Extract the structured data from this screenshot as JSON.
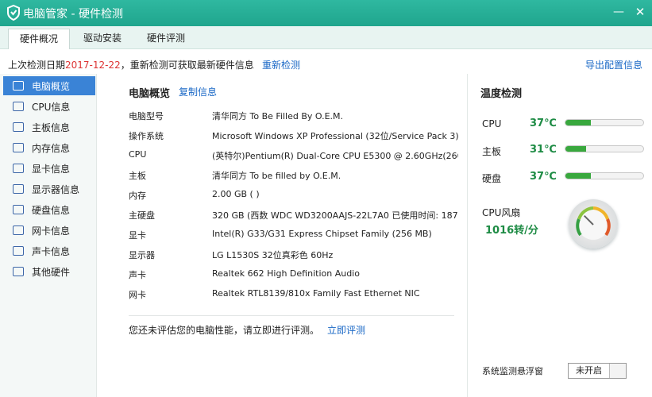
{
  "window": {
    "title": "电脑管家 - 硬件检测",
    "minimize_glyph": "—",
    "close_glyph": "✕",
    "accent": "#24ad94"
  },
  "tabs": [
    {
      "label": "硬件概况",
      "active": true
    },
    {
      "label": "驱动安装",
      "active": false
    },
    {
      "label": "硬件评测",
      "active": false
    }
  ],
  "infobar": {
    "prefix": "上次检测日期",
    "date": "2017-12-22",
    "suffix": "，重新检测可获取最新硬件信息",
    "rescan": "重新检测",
    "export": "导出配置信息"
  },
  "sidebar": {
    "items": [
      {
        "label": "电脑概览",
        "icon": "monitor-icon",
        "active": true
      },
      {
        "label": "CPU信息",
        "icon": "cpu-icon"
      },
      {
        "label": "主板信息",
        "icon": "motherboard-icon"
      },
      {
        "label": "内存信息",
        "icon": "memory-icon"
      },
      {
        "label": "显卡信息",
        "icon": "graphics-card-icon"
      },
      {
        "label": "显示器信息",
        "icon": "display-icon"
      },
      {
        "label": "硬盘信息",
        "icon": "hard-disk-icon"
      },
      {
        "label": "网卡信息",
        "icon": "network-card-icon"
      },
      {
        "label": "声卡信息",
        "icon": "sound-card-icon"
      },
      {
        "label": "其他硬件",
        "icon": "other-hardware-icon"
      }
    ]
  },
  "overview": {
    "title": "电脑概览",
    "copy": "复制信息",
    "rows": [
      {
        "key": "电脑型号",
        "value": "清华同方 To Be Filled By O.E.M."
      },
      {
        "key": "操作系统",
        "value": "Microsoft Windows XP Professional (32位/Service Pack 3)"
      },
      {
        "key": "CPU",
        "value": "(英特尔)Pentium(R) Dual-Core  CPU     E5300  @ 2.60GHz(260"
      },
      {
        "key": "主板",
        "value": "清华同方 To be filled by O.E.M."
      },
      {
        "key": "内存",
        "value": "2.00 GB ( )"
      },
      {
        "key": "主硬盘",
        "value": "320 GB (西数 WDC WD3200AAJS-22L7A0 已使用时间: 187..."
      },
      {
        "key": "显卡",
        "value": "Intel(R) G33/G31 Express Chipset Family (256 MB)"
      },
      {
        "key": "显示器",
        "value": "LG L1530S 32位真彩色 60Hz"
      },
      {
        "key": "声卡",
        "value": "Realtek 662 High Definition Audio"
      },
      {
        "key": "网卡",
        "value": "Realtek RTL8139/810x Family Fast Ethernet NIC"
      }
    ],
    "assess_text": "您还未评估您的电脑性能，请立即进行评测。",
    "assess_link": "立即评测"
  },
  "temperature": {
    "title": "温度检测",
    "rows": [
      {
        "label": "CPU",
        "value": "37℃",
        "fill": 0.33
      },
      {
        "label": "主板",
        "value": "31℃",
        "fill": 0.27
      },
      {
        "label": "硬盘",
        "value": "37℃",
        "fill": 0.33
      }
    ],
    "fan_label": "CPU风扇",
    "fan_value": "1016转/分",
    "float_label": "系统监测悬浮窗",
    "float_button": "未开启"
  }
}
